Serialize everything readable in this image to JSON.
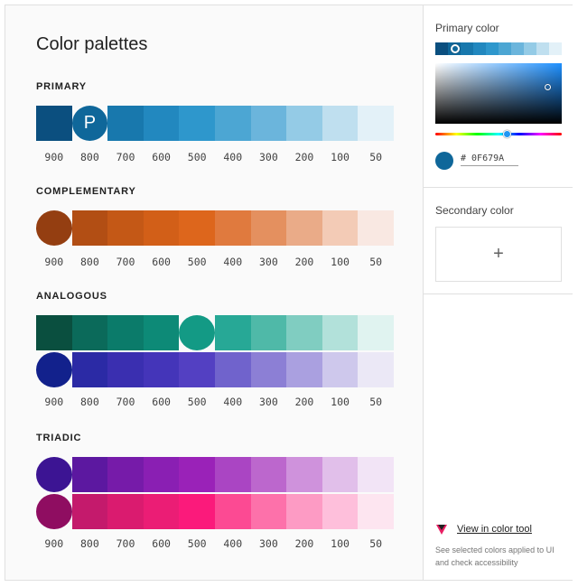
{
  "page": {
    "title": "Color palettes"
  },
  "shade_labels": [
    "900",
    "800",
    "700",
    "600",
    "500",
    "400",
    "300",
    "200",
    "100",
    "50"
  ],
  "sections": [
    {
      "label": "PRIMARY",
      "rows": [
        {
          "selected_index": 1,
          "selected_text": "P",
          "colors": [
            "#0b4f7f",
            "#0f679a",
            "#1878ad",
            "#2288bf",
            "#2e97cc",
            "#4ca6d3",
            "#6bb5dc",
            "#94cbe6",
            "#bfdfef",
            "#e3f1f8"
          ]
        }
      ]
    },
    {
      "label": "COMPLEMENTARY",
      "rows": [
        {
          "selected_index": 0,
          "selected_text": "",
          "colors": [
            "#943e11",
            "#b24e14",
            "#c45816",
            "#d25f18",
            "#dd661c",
            "#e07a3e",
            "#e4905f",
            "#eaab88",
            "#f3cbb6",
            "#f9e8e2"
          ]
        }
      ]
    },
    {
      "label": "ANALOGOUS",
      "rows": [
        {
          "selected_index": 4,
          "selected_text": "",
          "colors": [
            "#0a4f3f",
            "#0b6a5a",
            "#0b7b6a",
            "#0d8a77",
            "#139a85",
            "#27a896",
            "#4fb9a8",
            "#80cdc1",
            "#b2e1da",
            "#e0f3f0"
          ]
        },
        {
          "selected_index": 0,
          "selected_text": "",
          "colors": [
            "#12218c",
            "#2b2aa5",
            "#3a2fb0",
            "#4435b9",
            "#5340c2",
            "#7063cc",
            "#8c7fd5",
            "#aaa0e0",
            "#cec8ec",
            "#ebe8f6"
          ]
        }
      ]
    },
    {
      "label": "TRIADIC",
      "rows": [
        {
          "selected_index": 0,
          "selected_text": "",
          "colors": [
            "#3c1493",
            "#5c18a0",
            "#761ba9",
            "#8a1fb3",
            "#9a22b8",
            "#aa45c3",
            "#bc67cd",
            "#cf92dc",
            "#e1bfea",
            "#f2e4f6"
          ]
        },
        {
          "selected_index": 0,
          "selected_text": "",
          "colors": [
            "#8f0d61",
            "#c41a6c",
            "#da1b6f",
            "#eb1d75",
            "#fb1a7b",
            "#fc4a93",
            "#fd71aa",
            "#fd9bc4",
            "#febfdb",
            "#fde5f0"
          ]
        }
      ]
    }
  ],
  "sidebar": {
    "primary_title": "Primary color",
    "mini_strip": [
      "#0b4f7f",
      "#0f679a",
      "#1878ad",
      "#2288bf",
      "#2e97cc",
      "#4ca6d3",
      "#6bb5dc",
      "#94cbe6",
      "#bfdfef",
      "#e3f1f8"
    ],
    "current_color": "#0f679a",
    "hex_value": "# 0F679A",
    "secondary_title": "Secondary color",
    "add_label": "+",
    "tool_link": "View in color tool",
    "tool_desc": "See selected colors applied to UI and check accessibility"
  }
}
